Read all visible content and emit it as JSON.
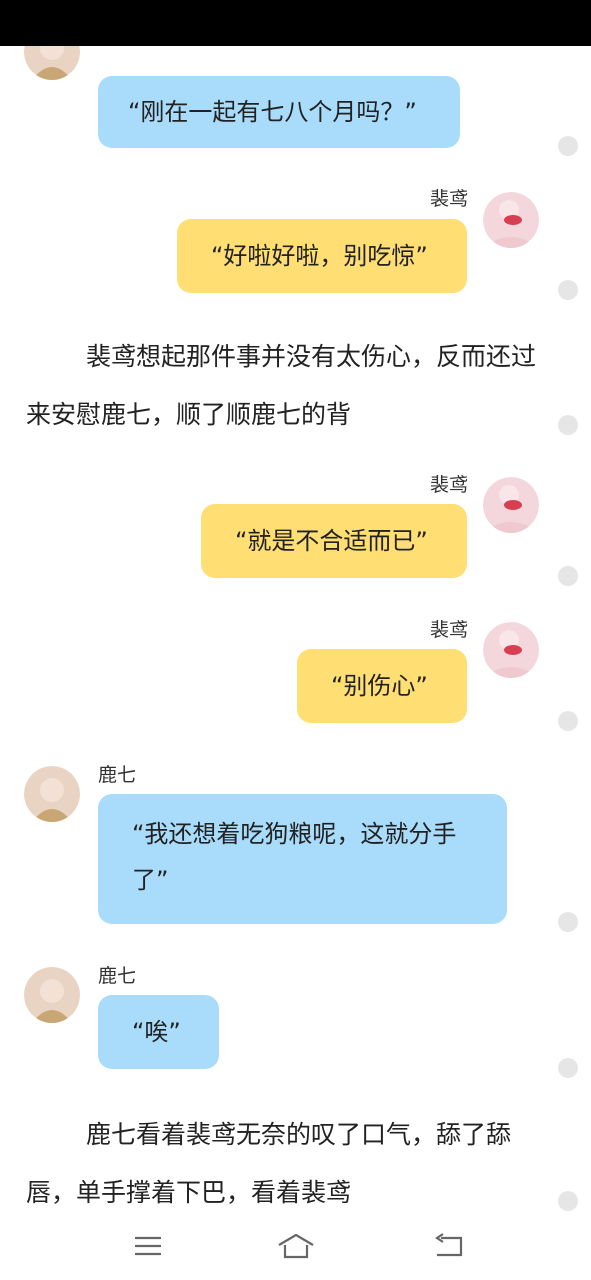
{
  "messages": [
    {
      "side": "left",
      "name": "",
      "text": "“刚在一起有七八个月吗？”"
    },
    {
      "side": "right",
      "name": "裴鸢",
      "text": "“好啦好啦，别吃惊”"
    },
    {
      "side": "right",
      "name": "裴鸢",
      "text": "“就是不合适而已”"
    },
    {
      "side": "right",
      "name": "裴鸢",
      "text": "“别伤心”"
    },
    {
      "side": "left",
      "name": "鹿七",
      "text": "“我还想着吃狗粮呢，这就分手\n了”"
    },
    {
      "side": "left",
      "name": "鹿七",
      "text": "“唉”"
    }
  ],
  "narration": [
    "裴鸢想起那件事并没有太伤心，反而还过来安慰鹿七，顺了顺鹿七的背",
    "鹿七看着裴鸢无奈的叹了口气，舔了舔唇，单手撑着下巴，看着裴鸢"
  ],
  "icons": {
    "nav_menu": "menu-icon",
    "nav_home": "home-icon",
    "nav_back": "back-icon"
  },
  "colors": {
    "left_bubble": "#a8dcfa",
    "right_bubble": "#ffde73",
    "status_bar": "#000000"
  }
}
